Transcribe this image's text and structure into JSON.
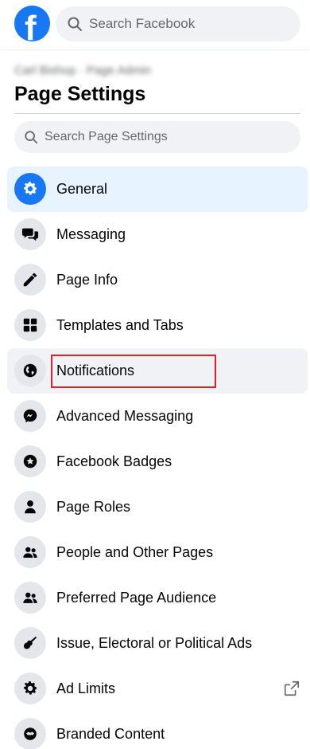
{
  "header": {
    "logo_letter": "f",
    "search_placeholder": "Search Facebook"
  },
  "page": {
    "blurred_name": "Carl Bishop · Page Admin",
    "title": "Page Settings",
    "search_placeholder": "Search Page Settings"
  },
  "menu": {
    "items": [
      {
        "label": "General",
        "icon": "gear-icon",
        "state": "active"
      },
      {
        "label": "Messaging",
        "icon": "chat-bubbles-icon"
      },
      {
        "label": "Page Info",
        "icon": "pencil-icon"
      },
      {
        "label": "Templates and Tabs",
        "icon": "grid-icon"
      },
      {
        "label": "Notifications",
        "icon": "globe-icon",
        "state": "hover",
        "highlighted": true
      },
      {
        "label": "Advanced Messaging",
        "icon": "messenger-icon"
      },
      {
        "label": "Facebook Badges",
        "icon": "star-badge-icon"
      },
      {
        "label": "Page Roles",
        "icon": "person-icon"
      },
      {
        "label": "People and Other Pages",
        "icon": "people-icon"
      },
      {
        "label": "Preferred Page Audience",
        "icon": "people-icon"
      },
      {
        "label": "Issue, Electoral or Political Ads",
        "icon": "guitar-icon"
      },
      {
        "label": "Ad Limits",
        "icon": "gear-icon",
        "external": true
      },
      {
        "label": "Branded Content",
        "icon": "handshake-icon"
      }
    ]
  },
  "colors": {
    "brand": "#1877f2",
    "active_bg": "#e7f3ff",
    "hover_bg": "#f0f2f5",
    "highlight": "#e41e26"
  }
}
